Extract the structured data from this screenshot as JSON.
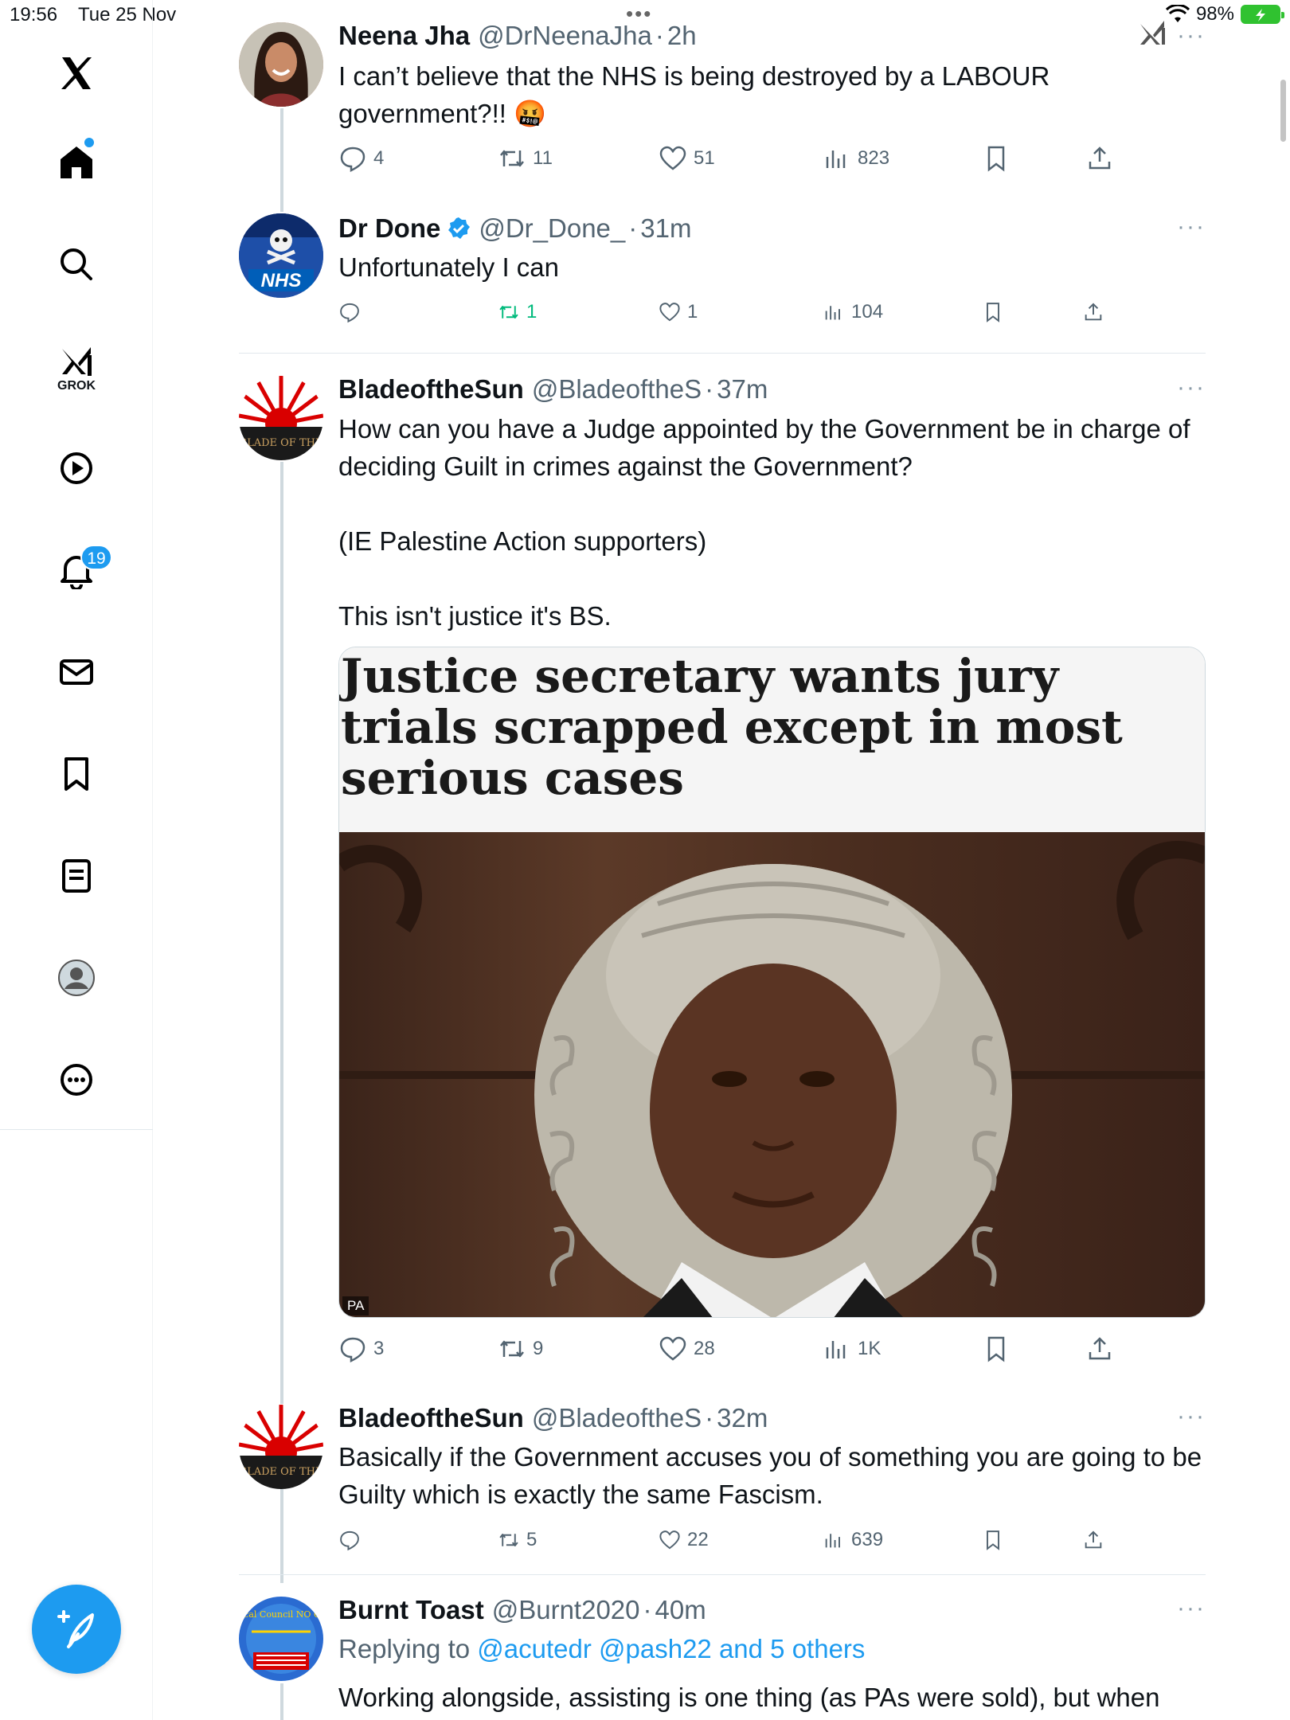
{
  "status_bar": {
    "time": "19:56",
    "date": "Tue 25 Nov",
    "dots": "•••",
    "battery": "98%"
  },
  "sidebar": {
    "items": [
      {
        "icon": "x-logo-icon"
      },
      {
        "icon": "home-icon"
      },
      {
        "icon": "search-icon"
      },
      {
        "icon": "grok-icon",
        "label": "GROK"
      },
      {
        "icon": "play-icon"
      },
      {
        "icon": "bell-icon",
        "badge": "19"
      },
      {
        "icon": "mail-icon"
      },
      {
        "icon": "bookmark-icon"
      },
      {
        "icon": "list-icon"
      },
      {
        "icon": "profile-icon"
      },
      {
        "icon": "more-icon"
      }
    ],
    "compose_icon": "compose-icon"
  },
  "colors": {
    "accent": "#1d9bf0",
    "retweeted": "#00ba7c",
    "text_secondary": "#536471"
  },
  "tweets": [
    {
      "name": "Neena Jha",
      "handle": "@DrNeenaJha",
      "sep": "·",
      "time": "2h",
      "text": "I can’t believe that the NHS is being destroyed by a LABOUR government?!! 🤬",
      "replies": "4",
      "retweets": "11",
      "likes": "51",
      "views": "823"
    },
    {
      "name": "Dr Done",
      "handle": "@Dr_Done_",
      "sep": "·",
      "time": "31m",
      "verified": true,
      "avatar_text": "NHS",
      "text": "Unfortunately I can",
      "replies": "",
      "retweets": "1",
      "likes": "1",
      "views": "104"
    },
    {
      "name": "BladeoftheSun",
      "handle": "@BladeoftheS",
      "sep": "·",
      "time": "37m",
      "avatar_text": "BLADE OF THE",
      "text": "How can you have a Judge appointed by the Government be in charge of deciding Guilt in crimes against the Government?\n\n(IE Palestine Action supporters)\n\nThis isn't justice it's BS.",
      "card_headline": "Justice secretary wants jury trials scrapped except in most serious cases",
      "card_credit": "PA",
      "replies": "3",
      "retweets": "9",
      "likes": "28",
      "views": "1K"
    },
    {
      "name": "BladeoftheSun",
      "handle": "@BladeoftheS",
      "sep": "·",
      "time": "32m",
      "avatar_text": "BLADE OF THE",
      "text": "Basically if the Government accuses you of something you are going to be Guilty which is exactly the same Fascism.",
      "replies": "",
      "retweets": "5",
      "likes": "22",
      "views": "639"
    },
    {
      "name": "Burnt Toast",
      "handle": "@Burnt2020",
      "sep": "·",
      "time": "40m",
      "avatar_text": "General Medical Council NO CONFIDENCE",
      "replying_label": "Replying to",
      "replying_links": "@acutedr @pash22 and 5 others",
      "text": "Working alongside, assisting is one thing (as PAs were sold), but when"
    }
  ],
  "more_dots": "···"
}
